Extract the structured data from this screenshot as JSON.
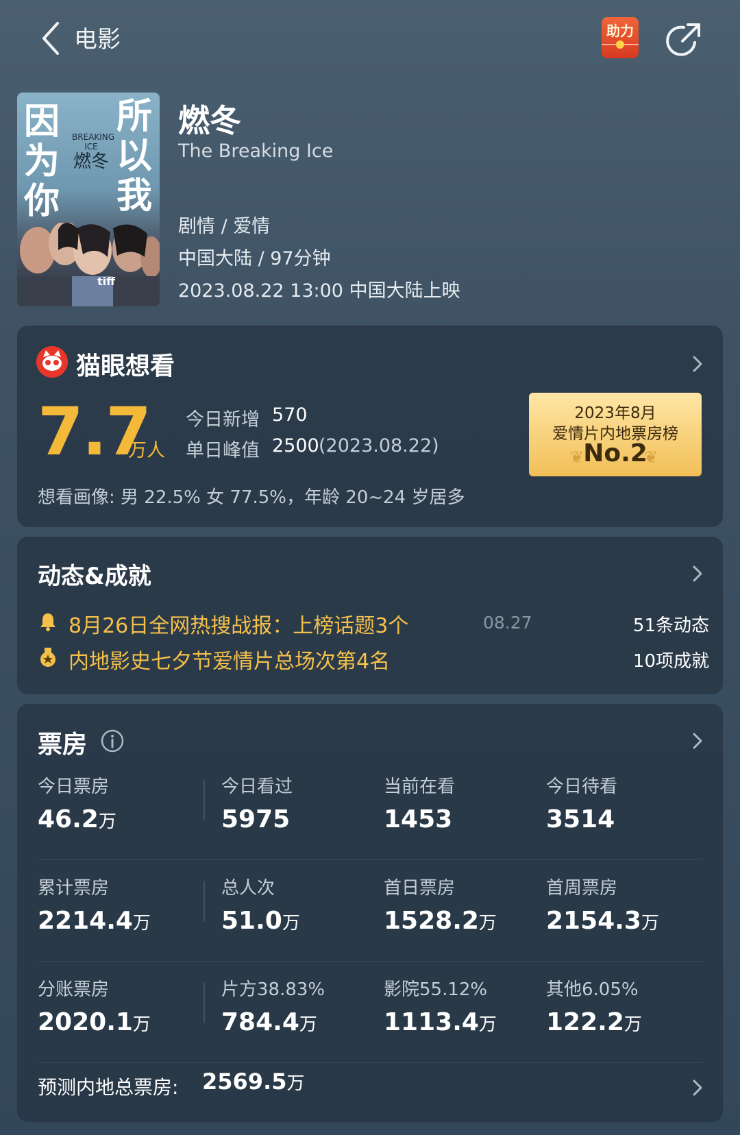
{
  "header": {
    "back_label": "电影",
    "help_label": "助力"
  },
  "movie": {
    "title": "燃冬",
    "english_title": "The Breaking Ice",
    "genre": "剧情 / 爱情",
    "origin_duration": "中国大陆 / 97分钟",
    "release": "2023.08.22 13:00 中国大陆上映",
    "poster": {
      "left_text": "因为你",
      "right_text": "所以我",
      "mid_small": "BREAKING ICE",
      "mid_big": "燃冬",
      "festival": "tiff"
    }
  },
  "want_to_see": {
    "title": "猫眼想看",
    "count": "7.7",
    "count_unit": "万人",
    "today_new_label": "今日新增",
    "today_new_value": "570",
    "daily_peak_label": "单日峰值",
    "daily_peak_value": "2500",
    "daily_peak_date": "(2023.08.22)",
    "portrait": "想看画像: 男 22.5%  女 77.5%，年龄 20~24 岁居多",
    "rank": {
      "line1": "2023年8月",
      "line2": "爱情片内地票房榜",
      "position": "No.2"
    }
  },
  "news": {
    "title": "动态&成就",
    "items": [
      {
        "text": "8月26日全网热搜战报：上榜话题3个",
        "date": "08.27",
        "count": "51条动态",
        "icon": "bell-icon"
      },
      {
        "text": "内地影史七夕节爱情片总场次第4名",
        "date": "",
        "count": "10项成就",
        "icon": "medal-icon"
      }
    ]
  },
  "box_office": {
    "title": "票房",
    "rows": [
      [
        {
          "label": "今日票房",
          "value": "46.2",
          "unit": "万"
        },
        {
          "label": "今日看过",
          "value": "5975",
          "unit": ""
        },
        {
          "label": "当前在看",
          "value": "1453",
          "unit": ""
        },
        {
          "label": "今日待看",
          "value": "3514",
          "unit": ""
        }
      ],
      [
        {
          "label": "累计票房",
          "value": "2214.4",
          "unit": "万"
        },
        {
          "label": "总人次",
          "value": "51.0",
          "unit": "万"
        },
        {
          "label": "首日票房",
          "value": "1528.2",
          "unit": "万"
        },
        {
          "label": "首周票房",
          "value": "2154.3",
          "unit": "万"
        }
      ],
      [
        {
          "label": "分账票房",
          "value": "2020.1",
          "unit": "万"
        },
        {
          "label": "片方38.83%",
          "value": "784.4",
          "unit": "万"
        },
        {
          "label": "影院55.12%",
          "value": "1113.4",
          "unit": "万"
        },
        {
          "label": "其他6.05%",
          "value": "122.2",
          "unit": "万"
        }
      ]
    ],
    "forecast_label": "预测内地总票房:",
    "forecast_value": "2569.5",
    "forecast_unit": "万"
  },
  "colors": {
    "accent_gold": "#f5b93a",
    "news_gold": "#f5c04a",
    "maoyan_red": "#e8362b",
    "card_bg": "#263442"
  }
}
